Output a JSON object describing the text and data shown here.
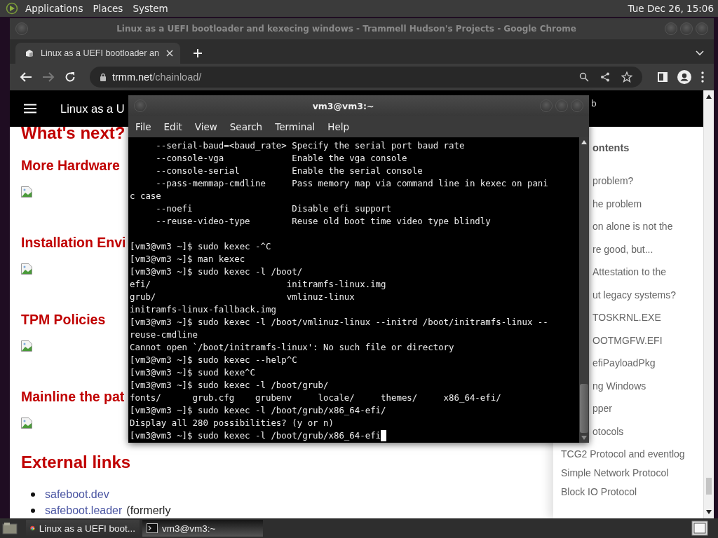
{
  "top_panel": {
    "menus": [
      "Applications",
      "Places",
      "System"
    ],
    "clock": "Tue Dec 26, 15:06"
  },
  "browser": {
    "title": "Linux as a UEFI bootloader and kexecing windows - Trammell Hudson's Projects - Google Chrome",
    "tabs": [
      {
        "label": "Linux as a UEFI bootloader an",
        "selected": true
      }
    ],
    "address": {
      "host": "trmm.net",
      "path": "/chainload/"
    },
    "forward_disabled": true,
    "page": {
      "header_title": "Linux as a U",
      "header_fragment": "b",
      "sections": [
        {
          "kind": "h2",
          "text": "What's next?"
        },
        {
          "kind": "h3",
          "text": "More Hardware"
        },
        {
          "kind": "image"
        },
        {
          "kind": "h3",
          "text": "Installation Envi"
        },
        {
          "kind": "image"
        },
        {
          "kind": "h3",
          "text": "TPM Policies"
        },
        {
          "kind": "image"
        },
        {
          "kind": "h3",
          "text": "Mainline the pat"
        },
        {
          "kind": "image"
        },
        {
          "kind": "h2",
          "text": "External links"
        },
        {
          "kind": "link",
          "text": "safeboot.dev"
        },
        {
          "kind": "link",
          "text": "safeboot.leader",
          "after": "(formerly"
        }
      ],
      "toc_title": "ontents",
      "toc": [
        {
          "kind": "clipped",
          "text": "problem?"
        },
        {
          "kind": "clipped",
          "text": "he problem"
        },
        {
          "kind": "clipped",
          "text": "on alone is not the"
        },
        {
          "kind": "clipped",
          "text": "re good, but..."
        },
        {
          "kind": "clipped",
          "text": "Attestation to the"
        },
        {
          "kind": "clipped",
          "text": "ut legacy systems?"
        },
        {
          "kind": "clipped",
          "text": "TOSKRNL.EXE"
        },
        {
          "kind": "clipped",
          "text": "OOTMGFW.EFI"
        },
        {
          "kind": "clipped",
          "text": "efiPayloadPkg"
        },
        {
          "kind": "clipped",
          "text": "ng Windows"
        },
        {
          "kind": "clipped",
          "text": "pper"
        },
        {
          "kind": "clipped",
          "text": "otocols"
        },
        {
          "kind": "full",
          "text": "TCG2 Protocol and eventlog"
        },
        {
          "kind": "full",
          "text": "Simple Network Protocol"
        },
        {
          "kind": "full",
          "text": "Block IO Protocol"
        }
      ]
    }
  },
  "terminal": {
    "title": "vm3@vm3:~",
    "menus": [
      "File",
      "Edit",
      "View",
      "Search",
      "Terminal",
      "Help"
    ],
    "cursor_visible": true,
    "blocks": [
      [
        "     --serial-baud=<baud_rate> Specify the serial port baud rate",
        "     --console-vga             Enable the vga console",
        "     --console-serial          Enable the serial console",
        "     --pass-memmap-cmdline     Pass memory map via command line in kexec on pani",
        "c case",
        "     --noefi                   Disable efi support",
        "     --reuse-video-type        Reuse old boot time video type blindly"
      ],
      [
        "[vm3@vm3 ~]$ sudo kexec -^C",
        "[vm3@vm3 ~]$ man kexec",
        "[vm3@vm3 ~]$ sudo kexec -l /boot/",
        "efi/                          initramfs-linux.img",
        "grub/                         vmlinuz-linux",
        "initramfs-linux-fallback.img",
        "[vm3@vm3 ~]$ sudo kexec -l /boot/vmlinuz-linux --initrd /boot/initramfs-linux --",
        "reuse-cmdline",
        "Cannot open `/boot/initramfs-linux': No such file or directory",
        "[vm3@vm3 ~]$ sudo kexec --help^C",
        "[vm3@vm3 ~]$ suod kexe^C",
        "[vm3@vm3 ~]$ sudo kexec -l /boot/grub/",
        "fonts/      grub.cfg    grubenv     locale/     themes/     x86_64-efi/",
        "[vm3@vm3 ~]$ sudo kexec -l /boot/grub/x86_64-efi/",
        "Display all 280 possibilities? (y or n)",
        "[vm3@vm3 ~]$ sudo kexec -l /boot/grub/x86_64-efi"
      ]
    ]
  },
  "taskbar": [
    {
      "kind": "browser",
      "label": "Linux as a UEFI boot...",
      "selected": false
    },
    {
      "kind": "terminal",
      "label": "vm3@vm3:~",
      "selected": true
    }
  ]
}
